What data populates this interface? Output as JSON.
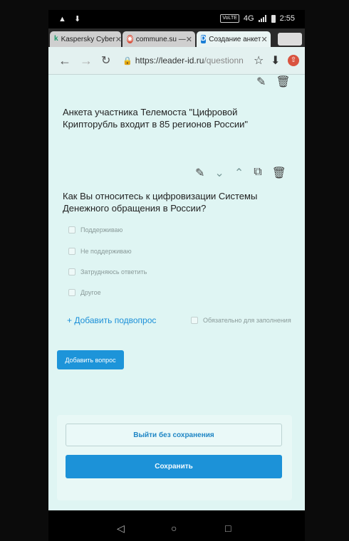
{
  "status": {
    "left_icons": "▲ ⬇",
    "volte": "VoLTE",
    "network": "4G",
    "time": "2:55"
  },
  "tabs": [
    {
      "favicon": "k",
      "title": "Kaspersky Cyber"
    },
    {
      "favicon": "◉",
      "title": "commune.su — "
    },
    {
      "favicon": "D",
      "title": "Создание анкет"
    }
  ],
  "address": {
    "url_host": "https://leader-id.ru",
    "url_path": "/questionnaire?events"
  },
  "survey": {
    "title": "Анкета участника Телемоста \"Цифровой Крипторубль входит в 85 регионов России\""
  },
  "question": {
    "text": "Как Вы относитесь к цифровизации Системы Денежного обращения в России?",
    "options": [
      "Поддерживаю",
      "Не поддерживаю",
      "Затрудняюсь ответить",
      "Другое"
    ],
    "add_subquestion": "+ Добавить подвопрос",
    "required_label": "Обязательно для заполнения"
  },
  "add_question_button": "Добавить вопрос",
  "footer": {
    "exit_label": "Выйти без сохранения",
    "save_label": "Сохранить"
  }
}
